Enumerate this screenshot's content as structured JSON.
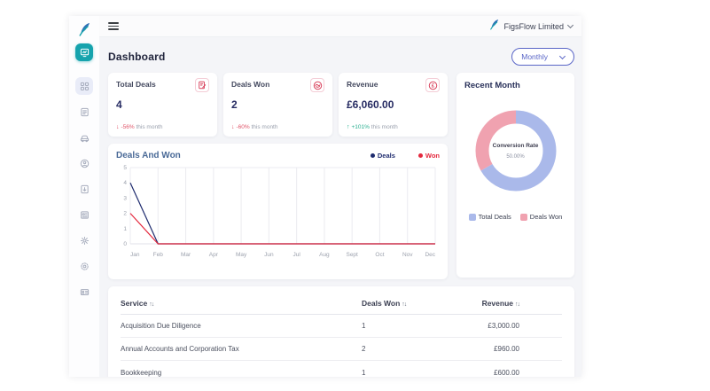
{
  "colors": {
    "accent_teal": "#16a3ad",
    "accent_indigo": "#5a66c7",
    "icon_red": "#d9455f",
    "value_navy": "#272c63",
    "deals_line": "#1e2b6e",
    "won_line": "#e4293e",
    "donut_blue": "#aab9ea",
    "donut_pink": "#f0a2b0",
    "down_red": "#e0556a",
    "up_green": "#27ae8f"
  },
  "header": {
    "company": "FigsFlow Limited",
    "logo_icon": "feather-logo-icon",
    "menu_icon": "hamburger-icon",
    "chevron_icon": "chevron-down-icon"
  },
  "sidebar": {
    "items": [
      {
        "icon": "dashboard-monitor-icon",
        "state": "active"
      },
      {
        "icon": "apps-grid-icon",
        "state": "hovered"
      },
      {
        "icon": "document-icon",
        "state": "default"
      },
      {
        "icon": "car-icon",
        "state": "default"
      },
      {
        "icon": "user-circle-icon",
        "state": "default"
      },
      {
        "icon": "file-export-icon",
        "state": "default"
      },
      {
        "icon": "news-document-icon",
        "state": "default"
      },
      {
        "icon": "gear-icon",
        "state": "default"
      },
      {
        "icon": "gear-outline-icon",
        "state": "default"
      },
      {
        "icon": "id-card-icon",
        "state": "default"
      }
    ]
  },
  "page": {
    "title": "Dashboard",
    "period_selected": "Monthly"
  },
  "stats": [
    {
      "title": "Total Deals",
      "value": "4",
      "icon": "document-pen-icon",
      "direction": "down",
      "arrow": "↓",
      "change_pct": "-56%",
      "change_suffix": " this month"
    },
    {
      "title": "Deals Won",
      "value": "2",
      "icon": "handshake-icon",
      "direction": "down",
      "arrow": "↓",
      "change_pct": "-60%",
      "change_suffix": " this month"
    },
    {
      "title": "Revenue",
      "value": "£6,060.00",
      "icon": "pound-circle-icon",
      "direction": "up",
      "arrow": "↑",
      "change_pct": "+101%",
      "change_suffix": " this month"
    }
  ],
  "chart_data": [
    {
      "type": "line",
      "title": "Deals And Won",
      "x": [
        "Jan",
        "Feb",
        "Mar",
        "Apr",
        "May",
        "Jun",
        "Jul",
        "Aug",
        "Sept",
        "Oct",
        "Nov",
        "Dec"
      ],
      "series": [
        {
          "name": "Deals",
          "color": "#1e2b6e",
          "values": [
            4,
            0,
            0,
            0,
            0,
            0,
            0,
            0,
            0,
            0,
            0,
            0
          ]
        },
        {
          "name": "Won",
          "color": "#e4293e",
          "values": [
            2,
            0,
            0,
            0,
            0,
            0,
            0,
            0,
            0,
            0,
            0,
            0
          ]
        }
      ],
      "ylim": [
        0,
        5
      ],
      "yticks": [
        0,
        1,
        2,
        3,
        4,
        5
      ],
      "legend_position": "top-right",
      "grid": "vertical-monthly"
    },
    {
      "type": "pie",
      "title": "Recent Month",
      "center_label": "Conversion Rate",
      "center_value": "50.00%",
      "slices": [
        {
          "label": "Total Deals",
          "value": 4,
          "color": "#aab9ea"
        },
        {
          "label": "Deals Won",
          "value": 2,
          "color": "#f0a2b0"
        }
      ],
      "legend_position": "bottom"
    }
  ],
  "table": {
    "sort_glyph": "↑↓",
    "headers": [
      "Service",
      "Deals Won",
      "Revenue"
    ],
    "rows": [
      [
        "Acquisition Due Diligence",
        "1",
        "£3,000.00"
      ],
      [
        "Annual Accounts and Corporation Tax",
        "2",
        "£960.00"
      ],
      [
        "Bookkeeping",
        "1",
        "£600.00"
      ]
    ]
  }
}
